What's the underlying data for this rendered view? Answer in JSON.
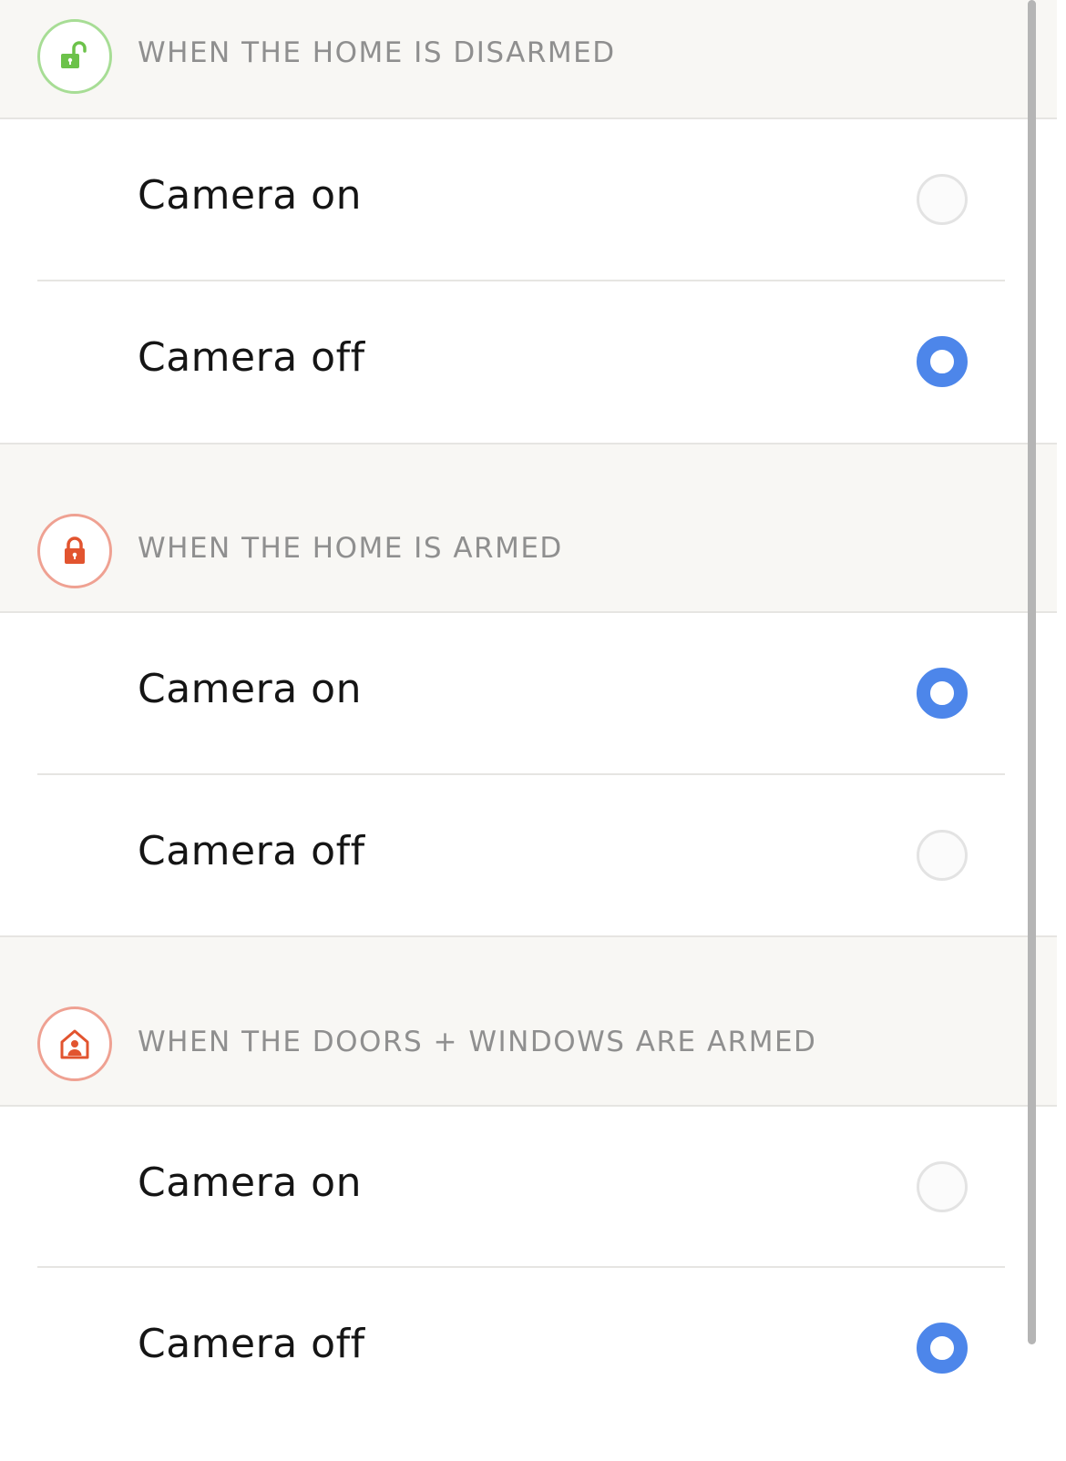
{
  "colors": {
    "header_bg": "#f8f7f4",
    "accent_selected": "#4d86ea",
    "disarmed_icon": "#6cc24a",
    "armed_icon": "#e2542f",
    "header_text": "#8f8f8f",
    "option_text": "#151515"
  },
  "sections": [
    {
      "title": "WHEN THE HOME IS DISARMED",
      "icon": "unlocked-padlock-icon",
      "options": [
        {
          "label": "Camera on",
          "selected": false
        },
        {
          "label": "Camera off",
          "selected": true
        }
      ]
    },
    {
      "title": "WHEN THE HOME IS ARMED",
      "icon": "locked-padlock-icon",
      "options": [
        {
          "label": "Camera on",
          "selected": true
        },
        {
          "label": "Camera off",
          "selected": false
        }
      ]
    },
    {
      "title": "WHEN THE DOORS + WINDOWS ARE ARMED",
      "icon": "house-person-icon",
      "options": [
        {
          "label": "Camera on",
          "selected": false
        },
        {
          "label": "Camera off",
          "selected": true
        }
      ]
    }
  ]
}
